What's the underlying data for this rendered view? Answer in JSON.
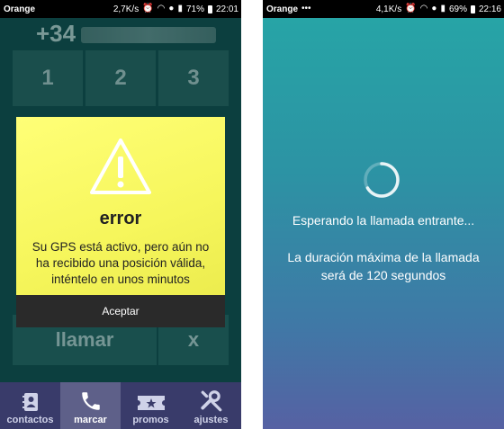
{
  "left": {
    "status": {
      "carrier": "Orange",
      "speed": "2,7K/s",
      "battery": "71%",
      "time": "22:01"
    },
    "dialer": {
      "prefix": "+34",
      "keys": [
        "1",
        "2",
        "3"
      ],
      "call_label": "llamar",
      "clear_label": "x"
    },
    "dialog": {
      "title": "error",
      "message_lines": [
        "Su GPS está activo, pero aún no",
        "ha recibido una posición válida,",
        "inténtelo en unos minutos"
      ],
      "button": "Aceptar"
    },
    "nav": [
      {
        "label": "contactos",
        "icon": "contacts-icon"
      },
      {
        "label": "marcar",
        "icon": "phone-icon"
      },
      {
        "label": "promos",
        "icon": "ticket-icon"
      },
      {
        "label": "ajustes",
        "icon": "tools-icon"
      }
    ]
  },
  "right": {
    "status": {
      "carrier": "Orange",
      "speed": "4,1K/s",
      "battery": "69%",
      "time": "22:16"
    },
    "waiting_text": "Esperando la llamada entrante...",
    "duration_lines": [
      "La duración máxima de la llamada",
      "será de 120 segundos"
    ]
  },
  "colors": {
    "dialog_yellow": "#f6f65c",
    "nav_bg": "#393b6a",
    "accent_teal": "#26a6a6"
  }
}
